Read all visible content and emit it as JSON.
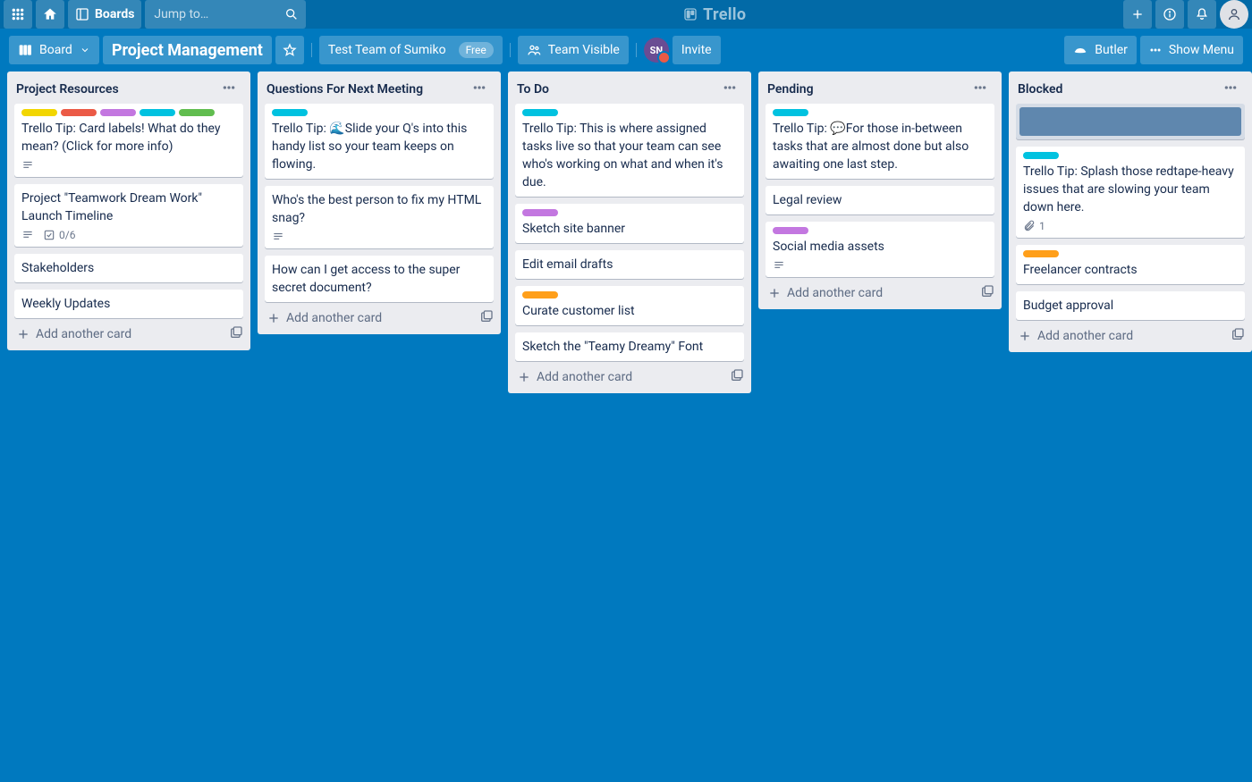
{
  "header": {
    "boards": "Boards",
    "search_ph": "Jump to…",
    "logo": "Trello"
  },
  "boardbar": {
    "board_label": "Board",
    "title": "Project Management",
    "team": "Test Team of Sumiko",
    "free": "Free",
    "visibility": "Team Visible",
    "member": "SN",
    "invite": "Invite",
    "butler": "Butler",
    "show_menu": "Show Menu"
  },
  "lists": [
    {
      "title": "Project Resources",
      "add": "Add another card",
      "cards": [
        {
          "labels": [
            "yellow",
            "red",
            "purple",
            "teal",
            "green"
          ],
          "text": "Trello Tip: Card labels! What do they mean? (Click for more info)",
          "badges": [
            "desc"
          ]
        },
        {
          "text": "Project \"Teamwork Dream Work\" Launch Timeline",
          "badges": [
            "desc",
            "check"
          ],
          "check": "0/6"
        },
        {
          "text": "Stakeholders"
        },
        {
          "text": "Weekly Updates"
        }
      ]
    },
    {
      "title": "Questions For Next Meeting",
      "add": "Add another card",
      "cards": [
        {
          "labels": [
            "teal"
          ],
          "text": "Trello Tip: 🌊Slide your Q's into this handy list so your team keeps on flowing."
        },
        {
          "text": "Who's the best person to fix my HTML snag?",
          "badges": [
            "desc"
          ]
        },
        {
          "text": "How can I get access to the super secret document?"
        }
      ]
    },
    {
      "title": "To Do",
      "add": "Add another card",
      "cards": [
        {
          "labels": [
            "teal"
          ],
          "text": "Trello Tip: This is where assigned tasks live so that your team can see who's working on what and when it's due."
        },
        {
          "labels": [
            "purple"
          ],
          "text": "Sketch site banner"
        },
        {
          "text": "Edit email drafts"
        },
        {
          "labels": [
            "orange"
          ],
          "text": "Curate customer list"
        },
        {
          "text": "Sketch the \"Teamy Dreamy\" Font"
        }
      ]
    },
    {
      "title": "Pending",
      "add": "Add another card",
      "cards": [
        {
          "labels": [
            "teal"
          ],
          "text": "Trello Tip: 💬For those in-between tasks that are almost done but also awaiting one last step."
        },
        {
          "text": "Legal review"
        },
        {
          "labels": [
            "purple"
          ],
          "text": "Social media assets",
          "badges": [
            "desc"
          ]
        }
      ]
    },
    {
      "title": "Blocked",
      "add": "Add another card",
      "composer": true,
      "cards": [
        {
          "labels": [
            "teal"
          ],
          "text": "Trello Tip: Splash those redtape-heavy issues that are slowing your team down here.",
          "badges": [
            "attach"
          ],
          "attach": "1"
        },
        {
          "labels": [
            "orange"
          ],
          "text": "Freelancer contracts"
        },
        {
          "text": "Budget approval"
        }
      ]
    }
  ]
}
